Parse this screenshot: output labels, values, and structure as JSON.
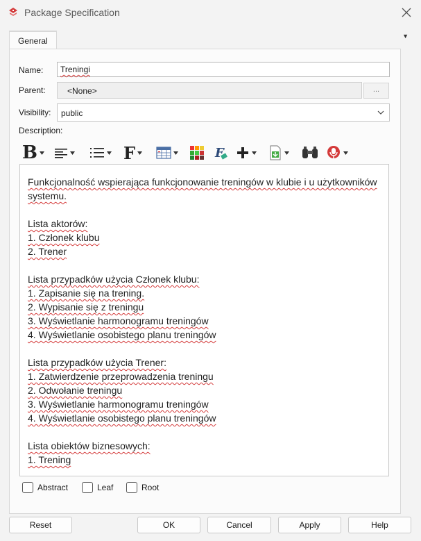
{
  "window": {
    "title": "Package Specification",
    "icon": "package-app-icon",
    "accent": "#d43a3a"
  },
  "tabs": [
    {
      "label": "General",
      "active": true
    }
  ],
  "form": {
    "name_label": "Name:",
    "name_value": "Treningi",
    "parent_label": "Parent:",
    "parent_value": "<None>",
    "parent_browse_label": "...",
    "visibility_label": "Visibility:",
    "visibility_value": "public",
    "description_label": "Description:"
  },
  "toolbar": {
    "icons": [
      "bold-icon",
      "align-icon",
      "list-icon",
      "font-icon",
      "table-icon",
      "color-fill-icon",
      "font-style-icon",
      "insert-icon",
      "import-icon",
      "find-icon",
      "spellcheck-icon"
    ]
  },
  "description": {
    "lines": [
      "Funkcjonalność wspierająca funkcjonowanie treningów w klubie i u użytkowników systemu.",
      "",
      "Lista aktorów:",
      "1. Członek klubu",
      "2. Trener",
      "",
      "Lista przypadków użycia Członek klubu:",
      "1. Zapisanie się na trening.",
      "2. Wypisanie się z treningu",
      "3. Wyświetlanie harmonogramu treningów",
      "4. Wyświetlanie osobistego planu treningów",
      "",
      "Lista przypadków użycia Trener:",
      "1. Zatwierdzenie przeprowadzenia treningu",
      "2. Odwołanie treningu",
      "3. Wyświetlanie harmonogramu treningów",
      "4. Wyświetlanie osobistego planu treningów",
      "",
      "Lista obiektów biznesowych:",
      "1. Trening"
    ]
  },
  "checkboxes": [
    {
      "label": "Abstract",
      "checked": false
    },
    {
      "label": "Leaf",
      "checked": false
    },
    {
      "label": "Root",
      "checked": false
    }
  ],
  "buttons": {
    "reset": "Reset",
    "ok": "OK",
    "cancel": "Cancel",
    "apply": "Apply",
    "help": "Help"
  }
}
